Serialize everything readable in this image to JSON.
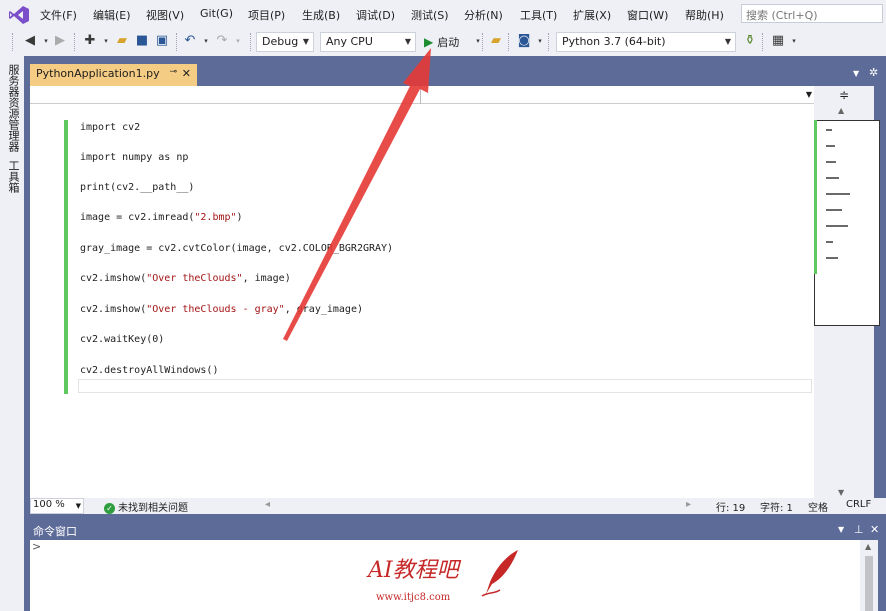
{
  "menubar": {
    "logo_icon": "visual-studio-icon",
    "items": [
      "文件(F)",
      "编辑(E)",
      "视图(V)",
      "Git(G)",
      "项目(P)",
      "生成(B)",
      "调试(D)",
      "测试(S)",
      "分析(N)",
      "工具(T)",
      "扩展(X)",
      "窗口(W)",
      "帮助(H)"
    ],
    "search_placeholder": "搜索 (Ctrl+Q)"
  },
  "toolbar": {
    "config": "Debug",
    "platform": "Any CPU",
    "start_label": "启动",
    "interpreter": "Python 3.7 (64-bit)"
  },
  "side_tabs": [
    "服务器资源管理器",
    "工具箱"
  ],
  "editor": {
    "tab_title": "PythonApplication1.py",
    "code_lines": [
      {
        "pre": "import cv2",
        "str": "",
        "post": ""
      },
      {
        "pre": "import numpy as np",
        "str": "",
        "post": ""
      },
      {
        "pre": "print(cv2.__path__)",
        "str": "",
        "post": ""
      },
      {
        "pre": "image = cv2.imread(",
        "str": "\"2.bmp\"",
        "post": ")"
      },
      {
        "pre": "gray_image = cv2.cvtColor(image, cv2.COLOR_BGR2GRAY)",
        "str": "",
        "post": ""
      },
      {
        "pre": "cv2.imshow(",
        "str": "\"Over theClouds\"",
        "post": ", image)"
      },
      {
        "pre": "cv2.imshow(",
        "str": "\"Over theClouds - gray\"",
        "post": ", gray_image)"
      },
      {
        "pre": "cv2.waitKey(0)",
        "str": "",
        "post": ""
      },
      {
        "pre": "cv2.destroyAllWindows()",
        "str": "",
        "post": ""
      }
    ]
  },
  "status": {
    "zoom": "100 %",
    "issues": "未找到相关问题",
    "line": "行: 19",
    "col": "字符: 1",
    "whitespace": "空格",
    "line_ending": "CRLF"
  },
  "command_window": {
    "title": "命令窗口",
    "prompt": ">"
  },
  "watermark": {
    "logo_text": "AI教程吧",
    "url": "www.itjc8.com"
  },
  "colors": {
    "frame": "#5d6b99",
    "tab_active": "#f5cc84",
    "change_bar": "#5fc95f",
    "annotation_arrow": "#e53935"
  }
}
